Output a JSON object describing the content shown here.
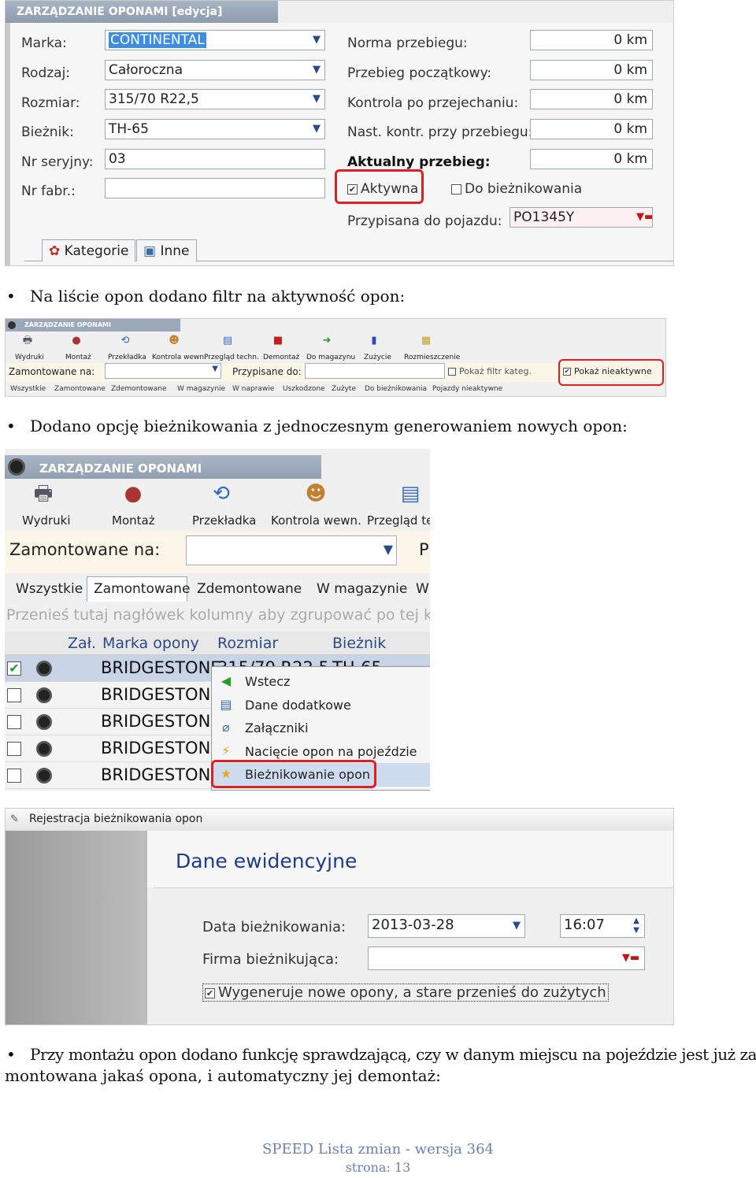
{
  "shot1": {
    "title": "ZARZĄDZANIE OPONAMI [edycja]",
    "left_fields": [
      {
        "label": "Marka:",
        "value": "CONTINENTAL",
        "dropdown": true,
        "selected": true
      },
      {
        "label": "Rodzaj:",
        "value": "Całoroczna",
        "dropdown": true
      },
      {
        "label": "Rozmiar:",
        "value": "315/70 R22,5",
        "dropdown": true
      },
      {
        "label": "Bieżnik:",
        "value": "TH-65",
        "dropdown": true
      },
      {
        "label": "Nr seryjny:",
        "value": "03"
      },
      {
        "label": "Nr fabr.:",
        "value": ""
      }
    ],
    "right_fields": [
      {
        "label": "Norma przebiegu:",
        "value": "0 km"
      },
      {
        "label": "Przebieg początkowy:",
        "value": "0 km"
      },
      {
        "label": "Kontrola po przejechaniu:",
        "value": "0 km"
      },
      {
        "label": "Nast. kontr. przy przebiegu:",
        "value": "0 km"
      },
      {
        "label": "Aktualny przebieg:",
        "value": "0 km",
        "bold": true
      }
    ],
    "checkbox_active": {
      "label": "Aktywna",
      "checked": true
    },
    "checkbox_retread": {
      "label": "Do bieżnikowania",
      "checked": false
    },
    "assigned_label": "Przypisana do pojazdu:",
    "assigned_value": "PO1345Y",
    "tabs": [
      "Kategorie",
      "Inne"
    ]
  },
  "bullet1": "Na liście opon dodano filtr na aktywność opon:",
  "shot2": {
    "title": "ZARZĄDZANIE OPONAMI",
    "toolbar": [
      "Wydruki",
      "Montaż",
      "Przekładka",
      "Kontrola wewn.",
      "Przegląd techn.",
      "Demontaż",
      "Do magazynu",
      "Zużycie",
      "Rozmieszczenie"
    ],
    "filter_label": "Zamontowane na:",
    "assigned_label": "Przypisane do:",
    "show_filter_cat": "Pokaż filtr kateg.",
    "show_inactive": "Pokaż nieaktywne",
    "tabs": [
      "Wszystkie",
      "Zamontowane",
      "Zdemontowane",
      "W magazynie",
      "W naprawie",
      "Uszkodzone",
      "Zużyte",
      "Do bieżnikowania",
      "Pojazdy nieaktywne"
    ]
  },
  "bullet2": "Dodano opcję bieżnikowania z jednoczesnym generowaniem nowych opon:",
  "shot3": {
    "title": "ZARZĄDZANIE OPONAMI",
    "toolbar": [
      "Wydruki",
      "Montaż",
      "Przekładka",
      "Kontrola wewn.",
      "Przegląd tec"
    ],
    "filter_label": "Zamontowane na:",
    "cut_letter": "P",
    "tabs": [
      "Wszystkie",
      "Zamontowane",
      "Zdemontowane",
      "W magazynie",
      "W"
    ],
    "group_hint": "Przenieś tutaj nagłówek kolumny aby zgrupować po tej kolu",
    "columns": [
      "Zał.",
      "Marka opony",
      "Rozmiar",
      "Bieżnik"
    ],
    "first_row_size": "315/70 R22,5",
    "first_row_tread": "TH-65",
    "rows": [
      "BRIDGESTONE",
      "BRIDGESTONE",
      "BRIDGESTONE",
      "BRIDGESTONE",
      "BRIDGESTONE"
    ],
    "menu": [
      "Wstecz",
      "Dane dodatkowe",
      "Załączniki",
      "Nacięcie opon na pojeździe",
      "Bieżnikowanie opon"
    ]
  },
  "shot4": {
    "title": "Rejestracja bieżnikowania opon",
    "heading": "Dane ewidencyjne",
    "date_label": "Data bieżnikowania:",
    "date_value": "2013-03-28",
    "time_value": "16:07",
    "company_label": "Firma bieżnikująca:",
    "company_value": "",
    "generate_label": "Wygeneruje nowe opony, a stare przenieś do zużytych",
    "generate_checked": true
  },
  "bullet3_line1": "Przy montażu opon dodano funkcję sprawdzającą, czy w danym miejscu na pojeździe jest już za-",
  "bullet3_line2": "montowana jakaś opona, i automatyczny jej demontaż:",
  "footer": {
    "title": "SPEED Lista zmian - wersja 364",
    "page": "strona: 13"
  },
  "colors": {
    "highlight": "#e02020",
    "title_bar": "#9aa8ba",
    "footer_text": "#6a7fb5"
  }
}
